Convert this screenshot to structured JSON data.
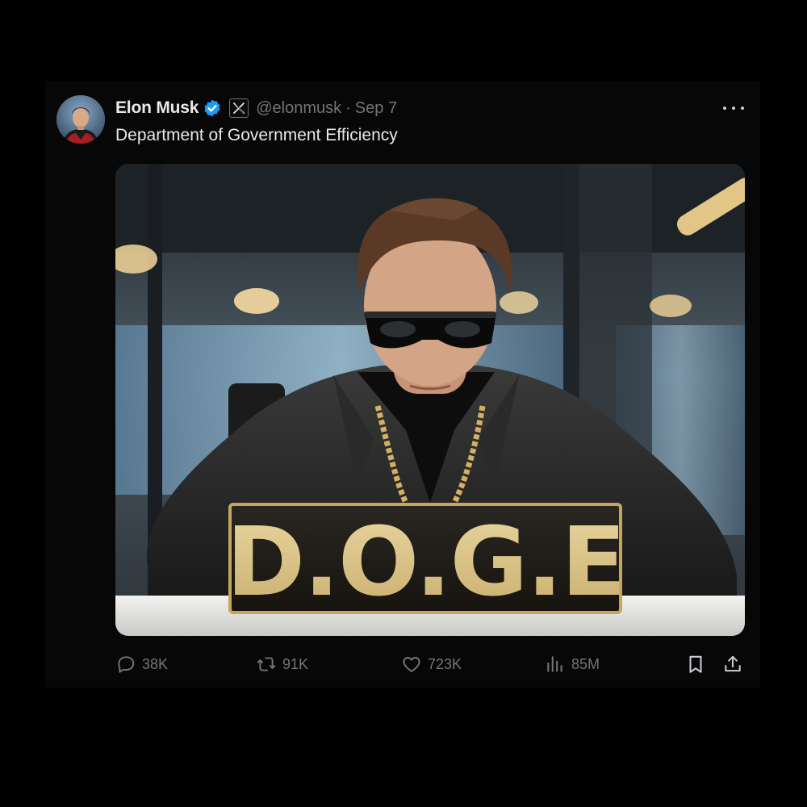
{
  "post": {
    "author_name": "Elon Musk",
    "handle": "@elonmusk",
    "separator": "·",
    "date": "Sep 7",
    "text": "Department of Government Efficiency",
    "verified_color": "#1d9bf0",
    "media": {
      "alt_label": "D.O.G.E",
      "sign_text": "D.O.G.E"
    },
    "stats": {
      "replies": "38K",
      "reposts": "91K",
      "likes": "723K",
      "views": "85M"
    },
    "icons": {
      "verified": "verified-badge-icon",
      "affiliate": "x-logo-icon",
      "more": "more-dots-icon",
      "reply": "reply-icon",
      "repost": "repost-icon",
      "like": "heart-icon",
      "views": "views-bar-chart-icon",
      "bookmark": "bookmark-icon",
      "share": "share-icon"
    }
  },
  "theme": {
    "background": "#000000",
    "card": "#070707",
    "text_primary": "#e7e9ea",
    "text_secondary": "#71767b"
  }
}
